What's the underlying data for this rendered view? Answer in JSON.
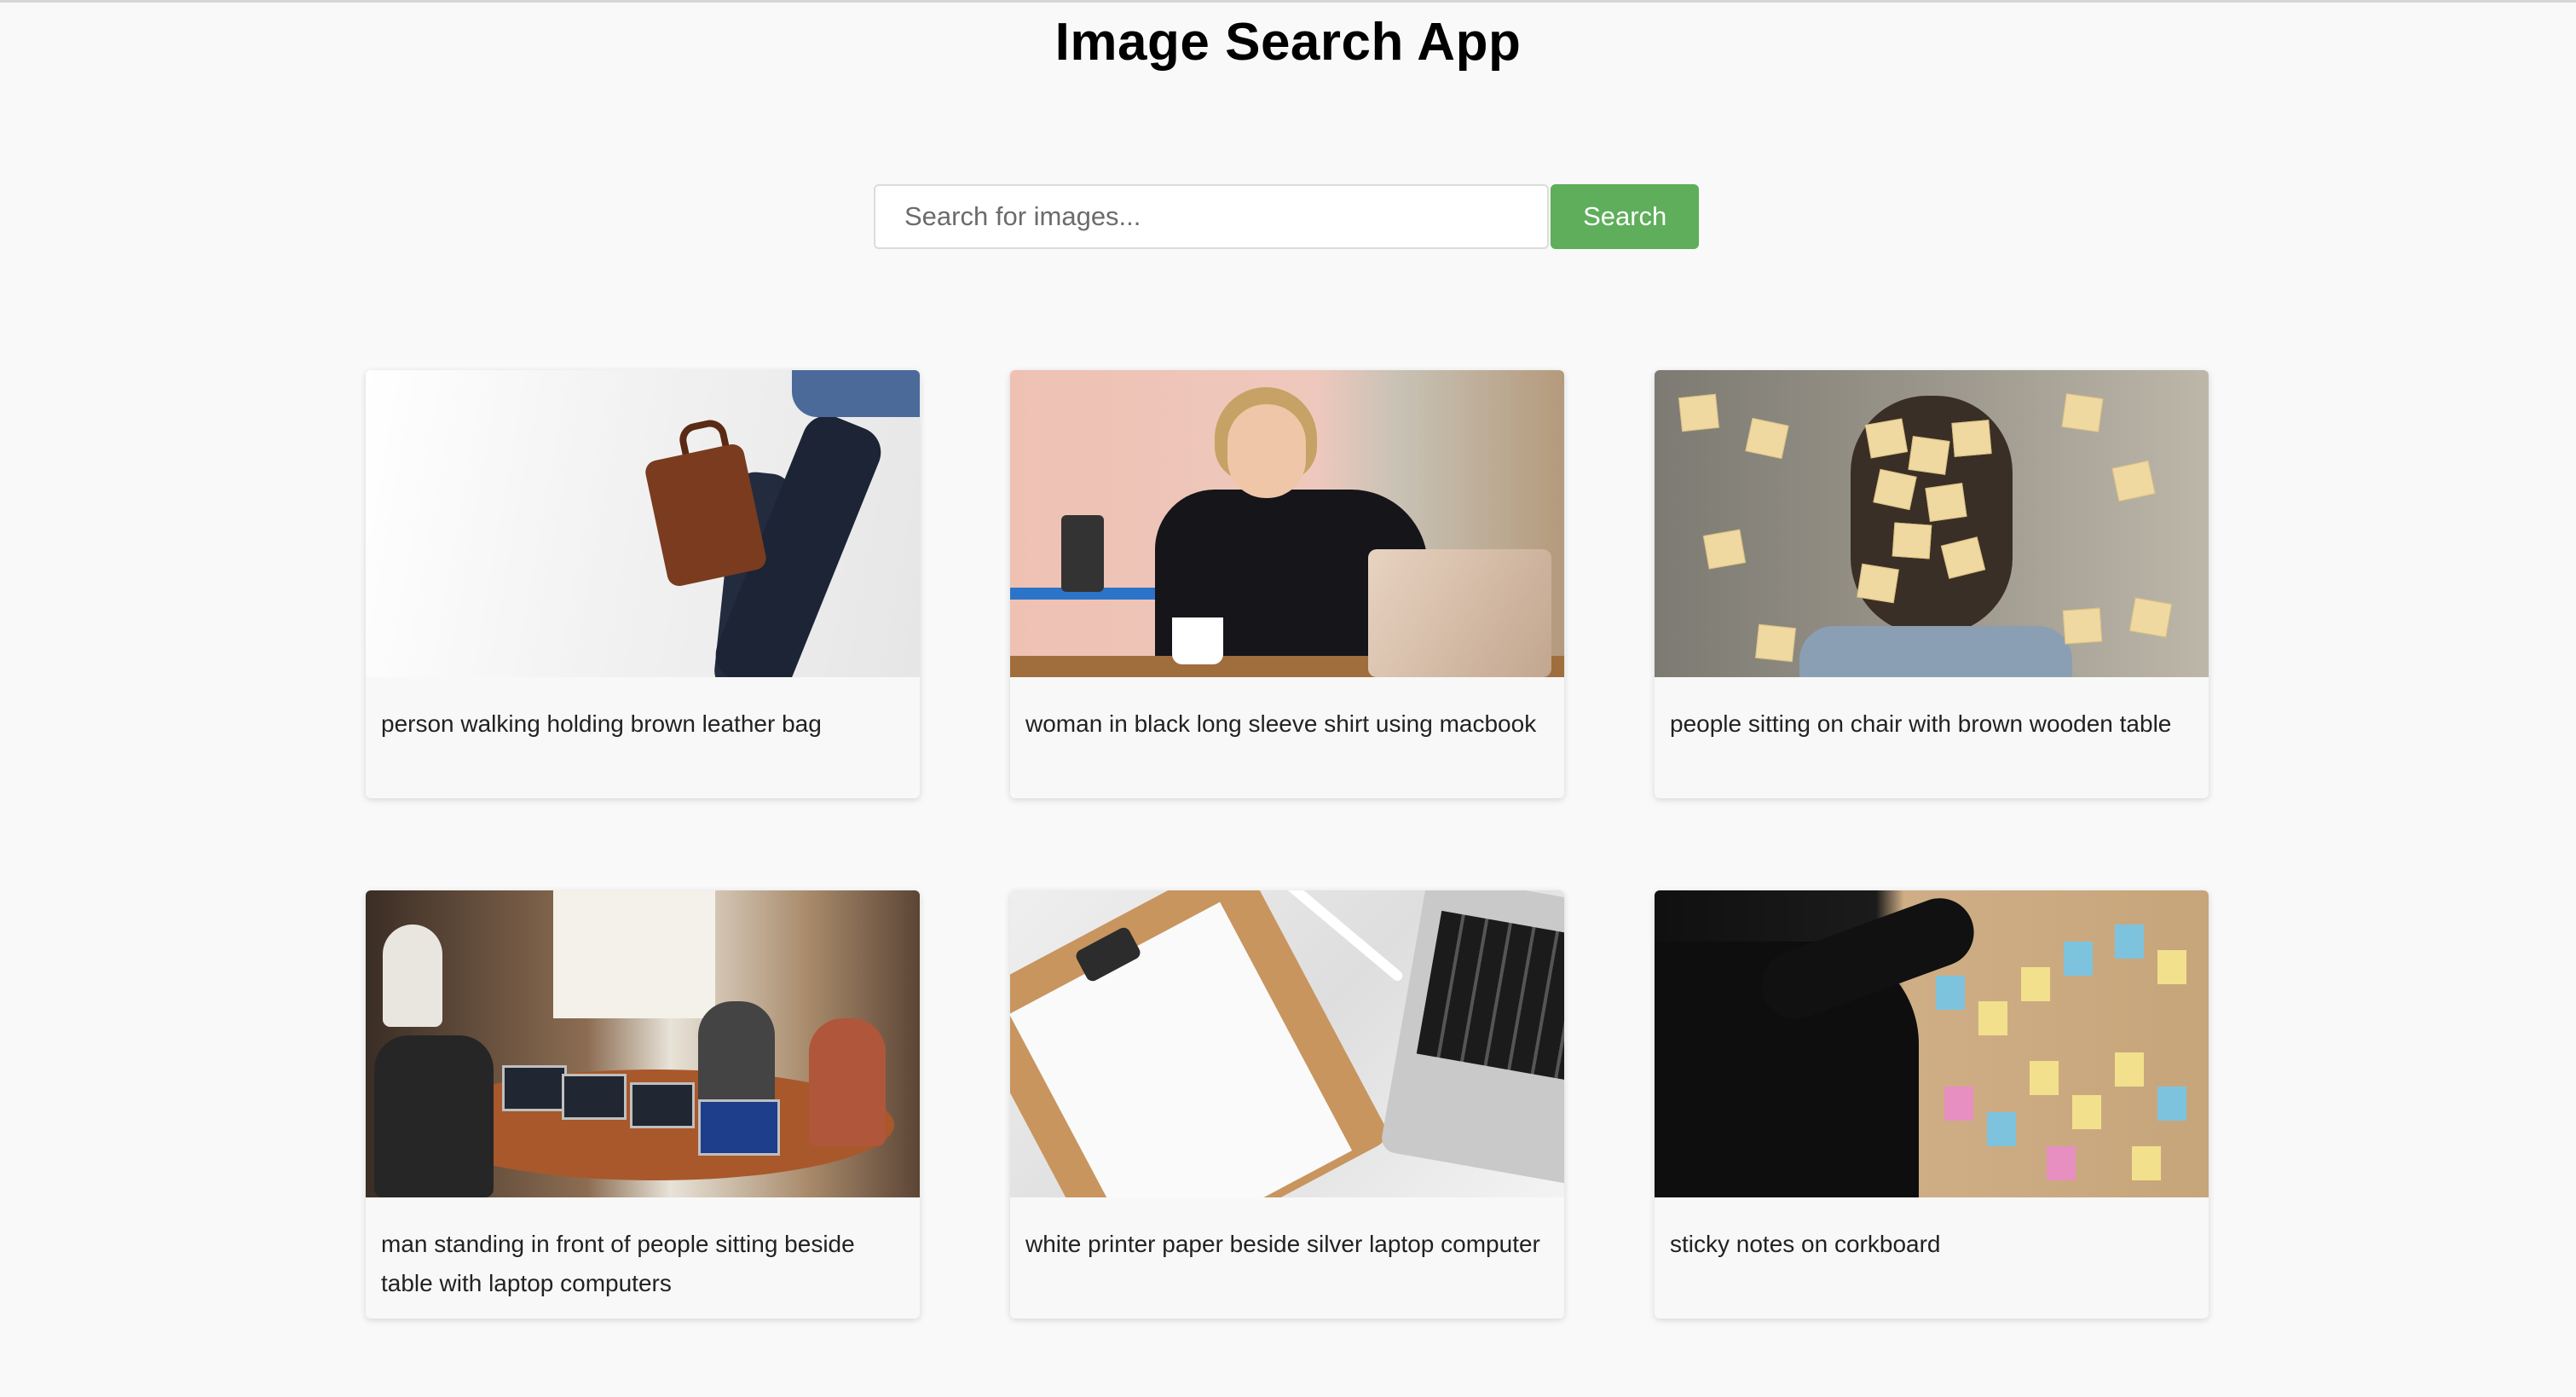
{
  "app": {
    "title": "Image Search App"
  },
  "search": {
    "placeholder": "Search for images...",
    "value": "",
    "button_label": "Search",
    "button_color": "#5eae5b"
  },
  "results": [
    {
      "caption": "person walking holding brown leather bag"
    },
    {
      "caption": "woman in black long sleeve shirt using macbook"
    },
    {
      "caption": "people sitting on chair with brown wooden table"
    },
    {
      "caption": "man standing in front of people sitting beside table with laptop computers"
    },
    {
      "caption": "white printer paper beside silver laptop computer"
    },
    {
      "caption": "sticky notes on corkboard"
    }
  ]
}
